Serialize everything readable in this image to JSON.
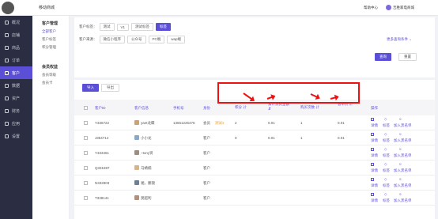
{
  "header": {
    "app_name": "移动商城",
    "help_label": "帮助中心",
    "user_name": "吉胜家电商城"
  },
  "sidebar": {
    "items": [
      {
        "label": "概况"
      },
      {
        "label": "店铺"
      },
      {
        "label": "商品"
      },
      {
        "label": "订单"
      },
      {
        "label": "客户"
      },
      {
        "label": "数据"
      },
      {
        "label": "资产"
      },
      {
        "label": "财务"
      },
      {
        "label": "应用"
      },
      {
        "label": "设置"
      }
    ]
  },
  "subnav": {
    "group1": "客户管理",
    "group1_links": [
      "全部客户",
      "客户标签",
      "积分管理"
    ],
    "group2": "会员权益",
    "group2_links": [
      "会员等级",
      "会员卡"
    ]
  },
  "filters": {
    "tag_label": "客户标签：",
    "tags": [
      "测试",
      "V1",
      "测试标签",
      "标签"
    ],
    "source_label": "客户来源：",
    "sources": [
      "微信小程序",
      "公众号",
      "PC端",
      "wap端"
    ],
    "more_label": "更多查询条件",
    "search_button": "查询",
    "reset_button": "重置"
  },
  "table_actions": {
    "import_button": "导入",
    "export_button": "导出"
  },
  "table": {
    "headers": {
      "id": "客户ID",
      "info": "客户信息",
      "phone": "手机号",
      "identity": "身份",
      "points": "积分",
      "spend": "累计消费金额",
      "orders": "购买次数",
      "avg": "客单价",
      "ops": "操作"
    },
    "rows": [
      {
        "id": "Y336722",
        "name": "yant龙蝶",
        "phone": "13661226476",
        "identity": "会员",
        "tag": "测试2",
        "points": "2",
        "spend": "0.01",
        "orders": "1",
        "avg": "0.01"
      },
      {
        "id": "J354714",
        "name": "小小龙",
        "phone": "",
        "identity": "客户",
        "tag": "",
        "points": "0",
        "spend": "0.01",
        "orders": "1",
        "avg": "0.01"
      },
      {
        "id": "Y333461",
        "name": "~tony贤",
        "phone": "",
        "identity": "客户",
        "tag": "",
        "points": "",
        "spend": "",
        "orders": "",
        "avg": ""
      },
      {
        "id": "Q331697",
        "name": "马婧楠",
        "phone": "",
        "identity": "客户",
        "tag": "",
        "points": "",
        "spend": "",
        "orders": "",
        "avg": ""
      },
      {
        "id": "N332803",
        "name": "湘，鹏镜",
        "phone": "",
        "identity": "客户",
        "tag": "",
        "points": "",
        "spend": "",
        "orders": "",
        "avg": ""
      },
      {
        "id": "T338141",
        "name": "莫超利",
        "phone": "",
        "identity": "客户",
        "tag": "",
        "points": "",
        "spend": "",
        "orders": "",
        "avg": ""
      }
    ],
    "ops": {
      "detail": "详情",
      "tag": "标签",
      "blacklist": "加入黑名单"
    }
  },
  "colors": {
    "accent": "#5b4ed7",
    "annotation": "#ee1111"
  }
}
